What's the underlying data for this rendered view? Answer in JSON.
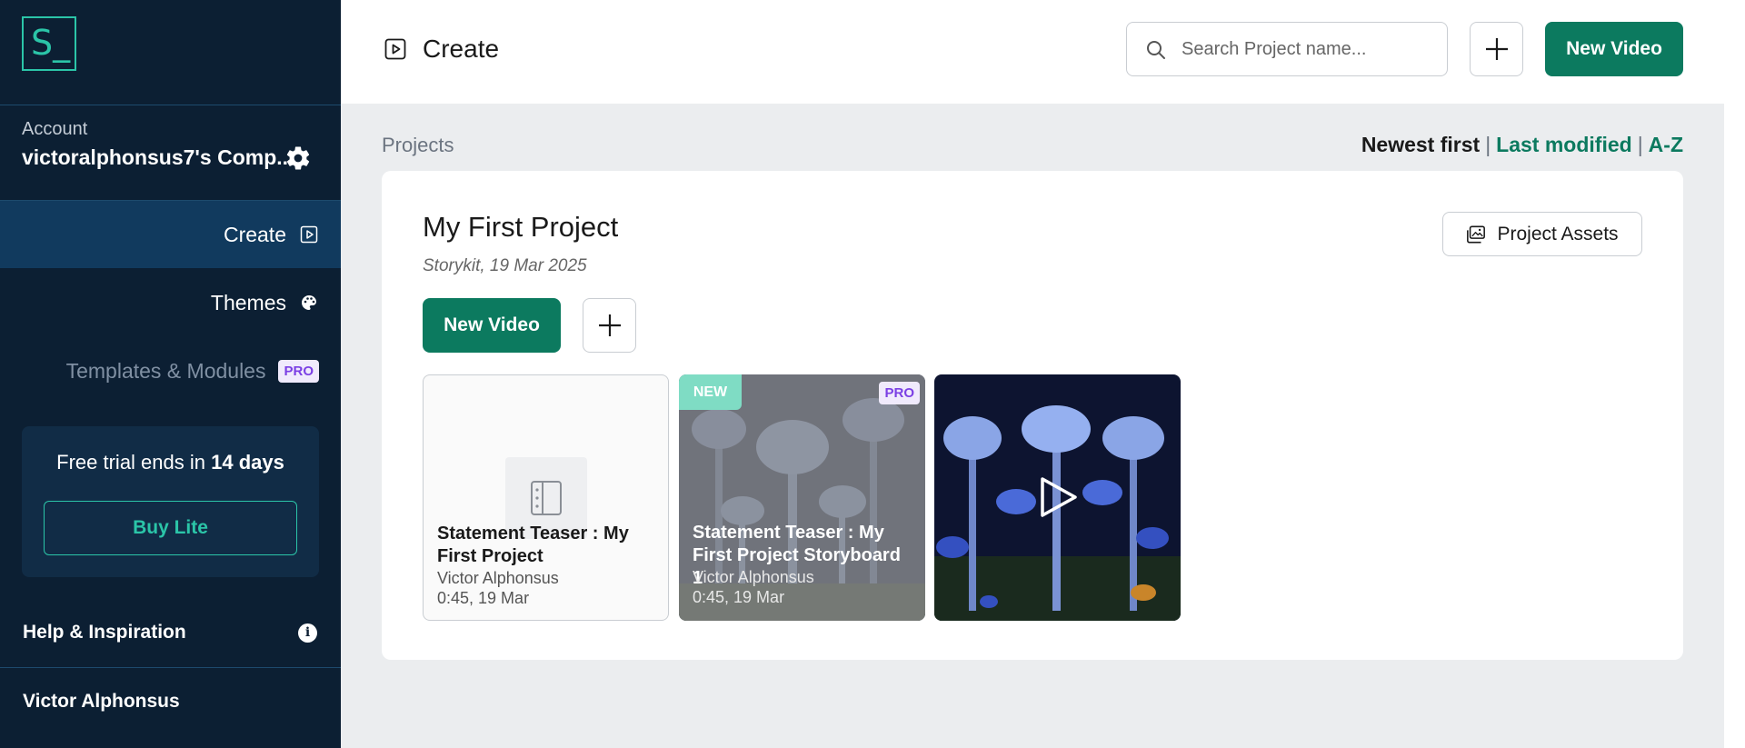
{
  "logo": {
    "text": "S_"
  },
  "account": {
    "label": "Account",
    "name": "victoralphonsus7's Comp..."
  },
  "nav": {
    "create": "Create",
    "themes": "Themes",
    "templates": "Templates & Modules",
    "pro": "PRO"
  },
  "trial": {
    "prefix": "Free trial ends in ",
    "days": "14 days",
    "buy": "Buy Lite"
  },
  "help": "Help & Inspiration",
  "user": "Victor Alphonsus",
  "header": {
    "title": "Create",
    "search_placeholder": "Search Project name...",
    "new_video": "New Video"
  },
  "projects": {
    "label": "Projects",
    "sort": {
      "newest": "Newest first",
      "sep": "|",
      "modified": "Last modified",
      "az": "A-Z"
    }
  },
  "project": {
    "title": "My First Project",
    "subtitle": "Storykit, 19 Mar 2025",
    "assets": "Project Assets",
    "new_video": "New Video",
    "tiles": [
      {
        "title": "Statement Teaser : My First Project",
        "author": "Victor Alphonsus",
        "meta": "0:45, 19 Mar"
      },
      {
        "title": "Statement Teaser : My First Project Storyboard 1",
        "author": "Victor Alphonsus",
        "meta": "0:45, 19 Mar",
        "badge": "NEW",
        "pro": "PRO"
      }
    ]
  },
  "colors": {
    "sidebar": "#0c1f33",
    "accent": "#0c7a5f",
    "teal": "#2bc5a8",
    "pro": "#7b3fe4"
  }
}
